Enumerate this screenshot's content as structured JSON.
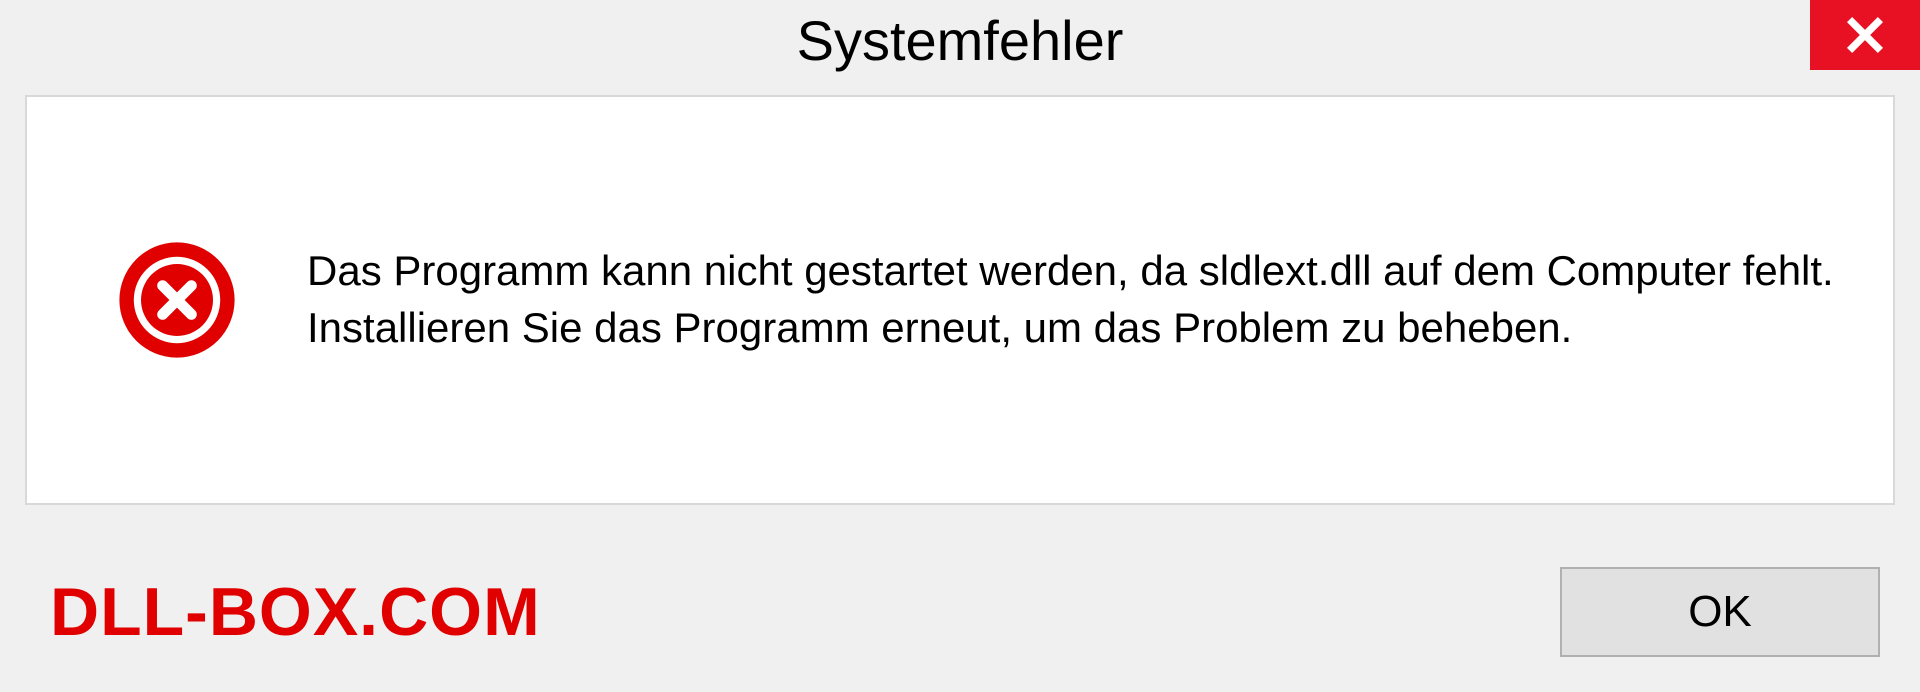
{
  "dialog": {
    "title": "Systemfehler",
    "message": "Das Programm kann nicht gestartet werden, da sldlext.dll auf dem Computer fehlt. Installieren Sie das Programm erneut, um das Problem zu beheben.",
    "ok_label": "OK"
  },
  "watermark": "DLL-BOX.COM"
}
